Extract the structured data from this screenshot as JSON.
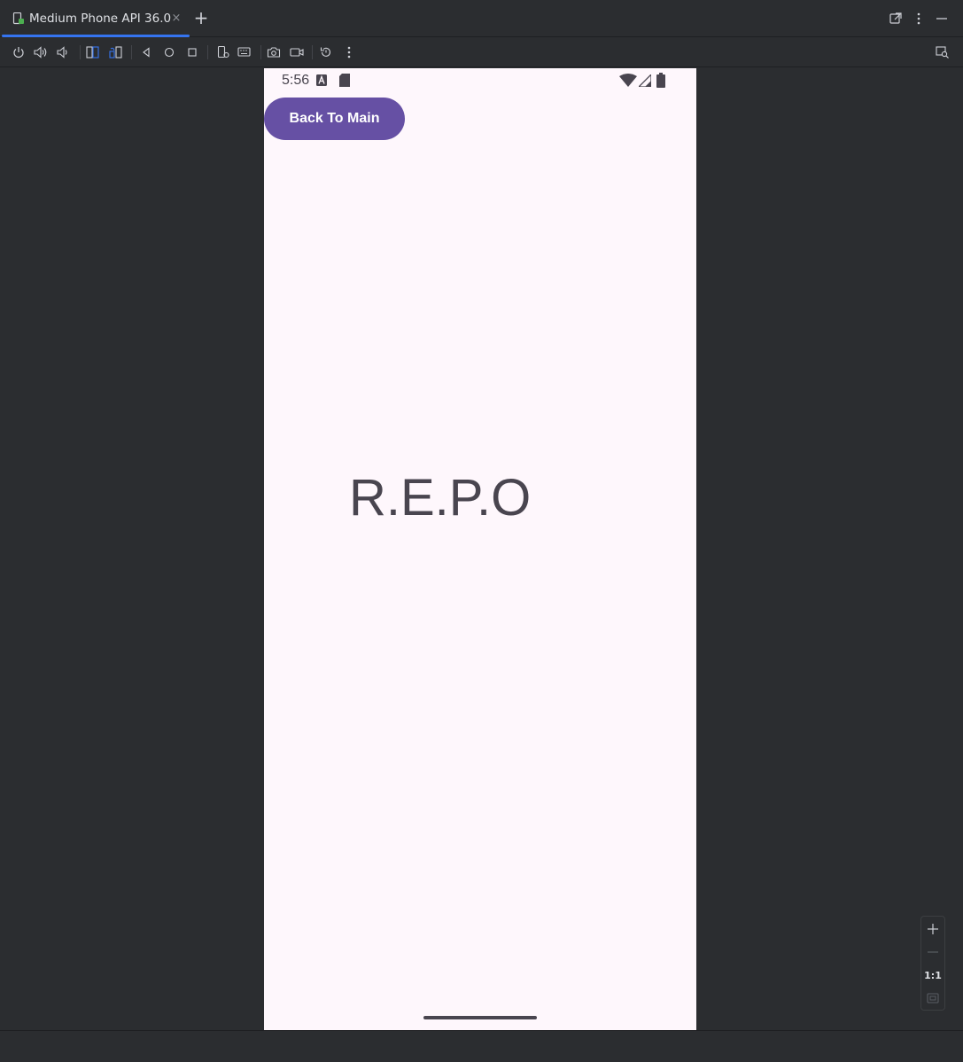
{
  "window": {
    "tab_title": "Medium Phone API 36.0",
    "tab_close": "×",
    "tab_add": "+"
  },
  "toolbar": {
    "icons": [
      "power-icon",
      "volume-up-icon",
      "volume-down-icon",
      "rotate-left-icon",
      "rotate-right-icon",
      "back-icon",
      "home-icon",
      "overview-icon",
      "device-settings-icon",
      "keyboard-icon",
      "screenshot-icon",
      "record-icon",
      "restore-icon",
      "more-icon"
    ]
  },
  "device": {
    "status_time": "5:56",
    "button_label": "Back To Main",
    "center_text": "R.E.P.O",
    "accent_color": "#6650a4",
    "background_color": "#fef7fc"
  },
  "zoom": {
    "zoom_in": "+",
    "zoom_out": "—",
    "actual_size": "1:1"
  }
}
